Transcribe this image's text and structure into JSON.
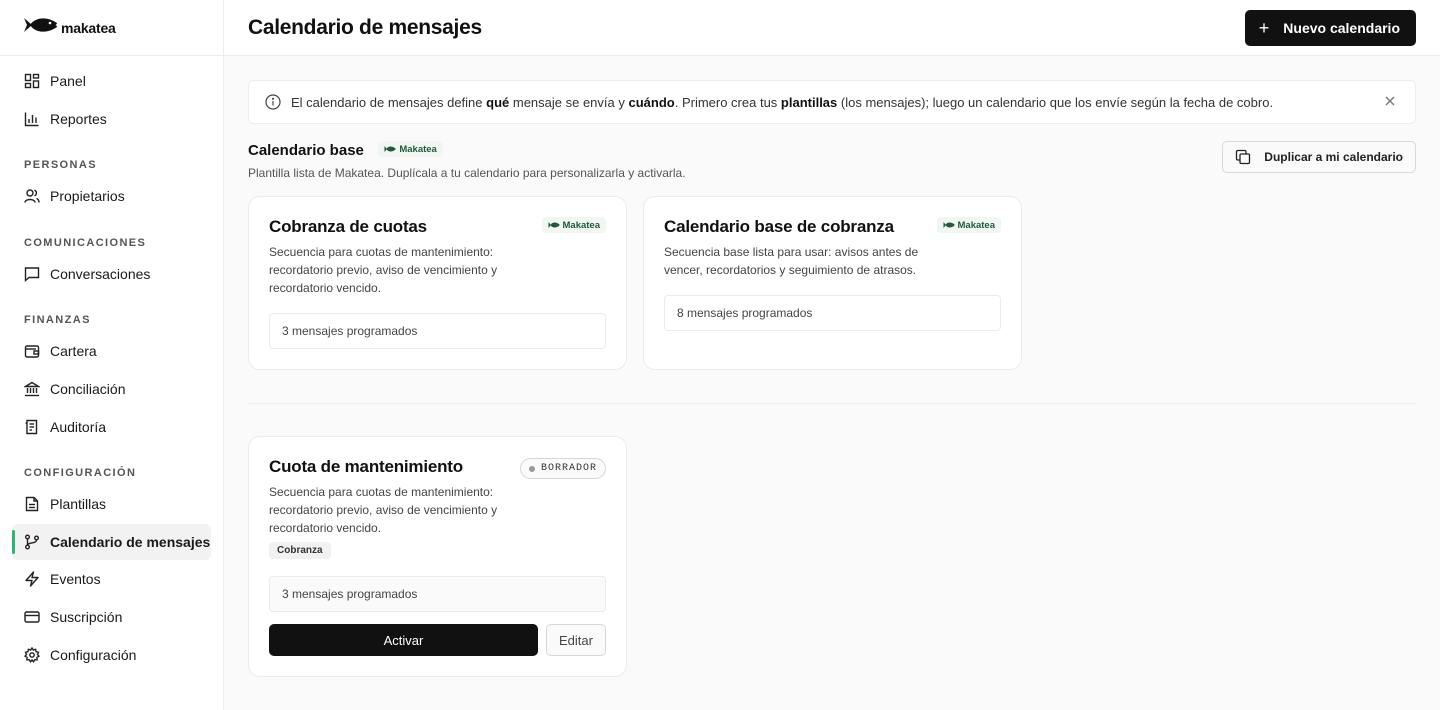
{
  "brand": {
    "name": "makatea"
  },
  "sidebar": {
    "items_top": [
      {
        "label": "Panel",
        "icon": "dashboard-icon"
      },
      {
        "label": "Reportes",
        "icon": "bar-chart-icon"
      }
    ],
    "sections": [
      {
        "title": "PERSONAS",
        "items": [
          {
            "label": "Propietarios",
            "icon": "users-icon"
          }
        ]
      },
      {
        "title": "COMUNICACIONES",
        "items": [
          {
            "label": "Conversaciones",
            "icon": "chat-icon"
          }
        ]
      },
      {
        "title": "FINANZAS",
        "items": [
          {
            "label": "Cartera",
            "icon": "wallet-icon"
          },
          {
            "label": "Conciliación",
            "icon": "bank-icon"
          },
          {
            "label": "Auditoría",
            "icon": "audit-icon"
          }
        ]
      },
      {
        "title": "CONFIGURACIÓN",
        "items": [
          {
            "label": "Plantillas",
            "icon": "file-icon"
          },
          {
            "label": "Calendario de mensajes",
            "icon": "branch-icon",
            "active": true
          },
          {
            "label": "Eventos",
            "icon": "bolt-icon"
          },
          {
            "label": "Suscripción",
            "icon": "card-icon"
          },
          {
            "label": "Configuración",
            "icon": "gear-icon"
          }
        ]
      }
    ],
    "accent_color": "#2bb673"
  },
  "header": {
    "title": "Calendario de mensajes",
    "new_button": "Nuevo calendario"
  },
  "info": {
    "t1": "El calendario de mensajes define ",
    "b1": "qué",
    "t2": " mensaje se envía y ",
    "b2": "cuándo",
    "t3": ". Primero crea tus ",
    "b3": "plantillas",
    "t4": " (los mensajes); luego un calendario que los envíe según la fecha de cobro."
  },
  "base": {
    "title": "Calendario base",
    "badge": "Makatea",
    "subtitle": "Plantilla lista de Makatea. Duplícala a tu calendario para personalizarla y activarla.",
    "duplicate_button": "Duplicar a mi calendario",
    "cards": [
      {
        "title": "Cobranza de cuotas",
        "badge": "Makatea",
        "description": "Secuencia para cuotas de mantenimiento: recordatorio previo, aviso de vencimiento y recordatorio vencido.",
        "count": "3 mensajes programados"
      },
      {
        "title": "Calendario base de cobranza",
        "badge": "Makatea",
        "description": "Secuencia base lista para usar: avisos antes de vencer, recordatorios y seguimiento de atrasos.",
        "count": "8 mensajes programados"
      }
    ]
  },
  "mine": {
    "cards": [
      {
        "title": "Cuota de mantenimiento",
        "status": "BORRADOR",
        "description": "Secuencia para cuotas de mantenimiento: recordatorio previo, aviso de vencimiento y recordatorio vencido.",
        "tag": "Cobranza",
        "count": "3 mensajes programados",
        "activate_button": "Activar",
        "edit_button": "Editar"
      }
    ]
  }
}
